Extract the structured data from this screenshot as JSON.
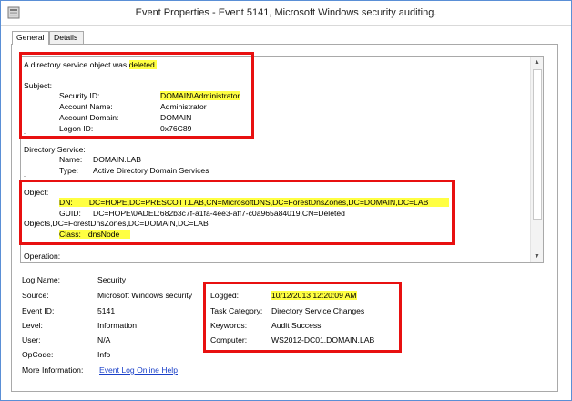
{
  "window": {
    "title": "Event Properties - Event 5141, Microsoft Windows security auditing."
  },
  "tabs": [
    {
      "label": "General",
      "active": true
    },
    {
      "label": "Details",
      "active": false
    }
  ],
  "description": {
    "intro_prefix": "A directory service object was ",
    "intro_highlight": "deleted.",
    "subject_header": "Subject:",
    "subject": {
      "security_id_label": "Security ID:",
      "security_id_value": "DOMAIN\\Administrator",
      "account_name_label": "Account Name:",
      "account_name_value": "Administrator",
      "account_domain_label": "Account Domain:",
      "account_domain_value": "DOMAIN",
      "logon_id_label": "Logon ID:",
      "logon_id_value": "0x76C89"
    },
    "directory_service_header": "Directory Service:",
    "directory_service": {
      "name_label": "Name:",
      "name_value": "DOMAIN.LAB",
      "type_label": "Type:",
      "type_value": "Active Directory Domain Services"
    },
    "object_header": "Object:",
    "object": {
      "dn_label": "DN:",
      "dn_value": "DC=HOPE,DC=PRESCOTT.LAB,CN=MicrosoftDNS,DC=ForestDnsZones,DC=DOMAIN,DC=LAB",
      "guid_label": "GUID:",
      "guid_value": "DC=HOPE\\0ADEL:682b3c7f-a1fa-4ee3-aff7-c0a965a84019,CN=Deleted",
      "guid_continuation": "Objects,DC=ForestDnsZones,DC=DOMAIN,DC=LAB",
      "class_label": "Class:",
      "class_value": "dnsNode"
    },
    "operation_header": "Operation:"
  },
  "meta": {
    "log_name_label": "Log Name:",
    "log_name_value": "Security",
    "source_label": "Source:",
    "source_value": "Microsoft Windows security",
    "event_id_label": "Event ID:",
    "event_id_value": "5141",
    "level_label": "Level:",
    "level_value": "Information",
    "user_label": "User:",
    "user_value": "N/A",
    "opcode_label": "OpCode:",
    "opcode_value": "Info",
    "more_info_label": "More Information:",
    "more_info_link": "Event Log Online Help",
    "logged_label": "Logged:",
    "logged_value": "10/12/2013 12:20:09 AM",
    "task_category_label": "Task Category:",
    "task_category_value": "Directory Service Changes",
    "keywords_label": "Keywords:",
    "keywords_value": "Audit Success",
    "computer_label": "Computer:",
    "computer_value": "WS2012-DC01.DOMAIN.LAB"
  },
  "colors": {
    "highlight": "#ffff42",
    "annotation_box": "#e81010",
    "link": "#1a40c8"
  }
}
